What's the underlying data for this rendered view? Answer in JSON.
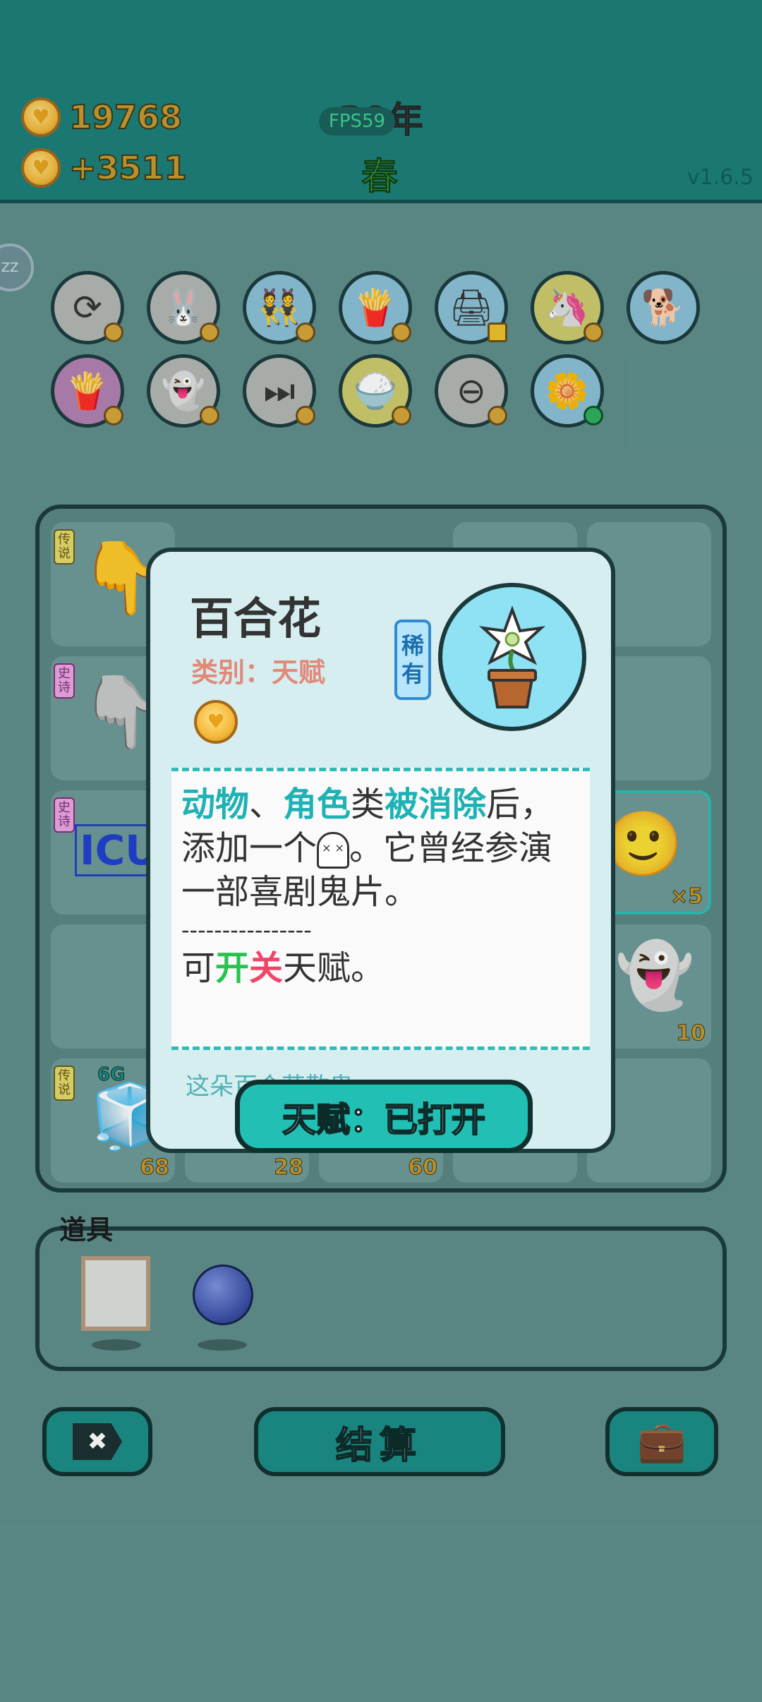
{
  "header": {
    "money": "19768",
    "income": "+3511",
    "year": "30年",
    "fps": "FPS59",
    "season": "春",
    "version": "v1.6.5"
  },
  "sleep_badge": "ZZ",
  "items_row": [
    {
      "icon": "refresh-icon",
      "bg": "#b5b7b2",
      "glyph": "⟳"
    },
    {
      "icon": "rabbit-icon",
      "bg": "#b5b7b2",
      "glyph": "🐰"
    },
    {
      "icon": "twins-icon",
      "bg": "#8bc0d6",
      "glyph": "👯"
    },
    {
      "icon": "fries-icon",
      "bg": "#8bc0d6",
      "glyph": "🍟"
    },
    {
      "icon": "printer-icon",
      "bg": "#8bc0d6",
      "glyph": "🖨"
    },
    {
      "icon": "unicorn-icon",
      "bg": "#cfca6b",
      "glyph": "🦄"
    },
    {
      "icon": "dog-icon",
      "bg": "#8bc0d6",
      "glyph": "🐕"
    },
    {
      "icon": "fries-icon",
      "bg": "#b37fb0",
      "glyph": "🍟"
    },
    {
      "icon": "ghost-icon",
      "bg": "#b5b7b2",
      "glyph": "👻"
    },
    {
      "icon": "skip-icon",
      "bg": "#b5b7b2",
      "glyph": "⏭"
    },
    {
      "icon": "rice-icon",
      "bg": "#cfca6b",
      "glyph": "🍚"
    },
    {
      "icon": "minus-icon",
      "bg": "#b5b7b2",
      "glyph": "⊖"
    },
    {
      "icon": "lily-icon",
      "bg": "#8bc0d6",
      "glyph": "🌼"
    }
  ],
  "board": {
    "cells": [
      {
        "tag": "传说",
        "tag_type": "legend",
        "glyph": "👇",
        "count": ""
      },
      {
        "tag": "史诗",
        "tag_type": "epic",
        "glyph": "👇",
        "count": ""
      },
      {
        "tag": "史诗",
        "tag_type": "epic",
        "glyph": "ICU",
        "count": ""
      },
      {
        "tag": "",
        "tag_type": "",
        "glyph": "",
        "count": ""
      },
      {
        "tag": "传说",
        "tag_type": "legend",
        "glyph": "🧊",
        "count": "68",
        "sub": "6G"
      },
      {
        "tag": "",
        "tag_type": "",
        "glyph": "",
        "count": "28"
      },
      {
        "tag": "",
        "tag_type": "",
        "glyph": "",
        "count": "60"
      },
      {
        "tag": "",
        "tag_type": "",
        "glyph": "🙂",
        "count": "×5"
      },
      {
        "tag": "",
        "tag_type": "",
        "glyph": "👻",
        "count": "10"
      }
    ]
  },
  "tools": {
    "label": "道具"
  },
  "buttons": {
    "cancel_icon": "✖",
    "settle": "结算",
    "bag_icon": "💼"
  },
  "modal": {
    "title": "百合花",
    "category": "类别：天赋",
    "rarity_line1": "稀",
    "rarity_line2": "有",
    "desc": {
      "kw1": "动物",
      "sep1": "、",
      "kw2": "角色",
      "mid1": "类",
      "kw3": "被消除",
      "mid2": "后，",
      "line2a": "添加一个",
      "ghost_face": "× ×",
      "line2b": "。它曾经参演",
      "line3": "一部喜剧鬼片。",
      "dashes": "----------------",
      "line4a": "可",
      "kw_open": "开",
      "kw_close": "关",
      "line4b": "天赋。"
    },
    "flavor": "这朵百合花敬鬼",
    "talent_button": "天赋：已打开"
  }
}
